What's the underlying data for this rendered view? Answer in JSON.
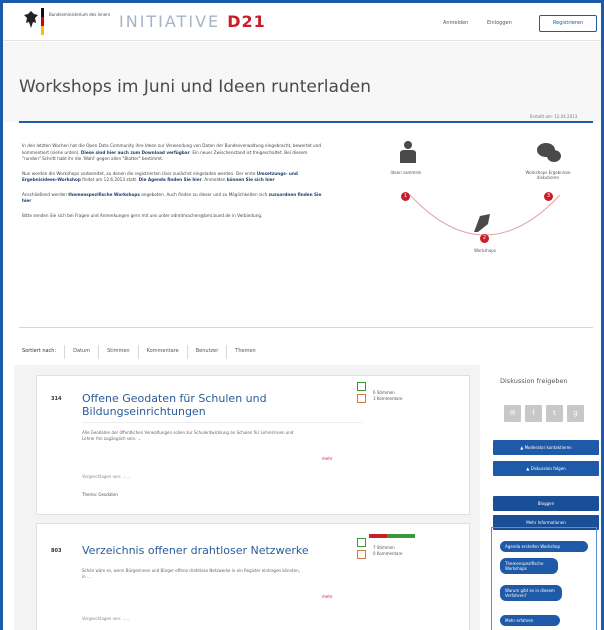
{
  "header": {
    "ministry": "Bundesministerium des Innern",
    "brand_prefix": "INITIATIVE",
    "brand_suffix": "D21",
    "brand_sub": "",
    "nav": [
      "Anmelden",
      "Einloggen"
    ],
    "register": "Registrieren"
  },
  "page": {
    "title": "Workshops im Juni und Ideen runterladen",
    "created": "Erstellt am: 12.04.2013"
  },
  "intro": {
    "p1a": "In den letzten Wochen hat die Open Data Community ihre Ideen zur Verwendung von Daten der Bundesverwaltung eingebracht, bewertet und kommentiert (siehe unten). ",
    "p1b": "Diese sind hier auch zum Download verfügbar",
    "p1c": ". Ein neuer Zwischenstand ist freigeschaltet. Bei diesem \"runden\" Schritt habt ihr die 'Wahl' gegen allen \"Blatter\" bestimmt.",
    "p2a": "Nun werden die Workshops vorbereitet, zu denen die registrierten User zunächst eingeladen werden. Der erste ",
    "p2b": "Umsetzungs- und Ergebnisideen-Workshop",
    "p2c": " findet am 12.6.2013 statt. ",
    "p2d": "Die Agenda finden Sie hier",
    "p2e": ". Anmelden ",
    "p2f": "können Sie sich hier",
    "p3a": "Anschließend werden ",
    "p3b": "themenspezifische Workshops",
    "p3c": " angeboten. Auch finden zu dieser und zu Möglichkeiten sich ",
    "p3d": "zuzuordnen finden Sie hier",
    "p4": "Bitte senden Sie sich bei Fragen und Anmerkungen gern mit uns unter odmitmachen@bmi.bund.de in Verbindung."
  },
  "diagram": {
    "step1": "Ideen sammeln",
    "step2": "Workshops",
    "step3": "Workshops Ergebnisse diskutieren",
    "n1": "1",
    "n2": "2",
    "n3": "3"
  },
  "tabs": [
    "Sortiert nach:",
    "Datum",
    "Stimmen",
    "Kommentare",
    "Benutzer",
    "Themen"
  ],
  "cards": [
    {
      "num": "314",
      "title": "Offene Geodaten für Schulen und Bildungseinrichtungen",
      "desc": "Alle Geodaten der öffentlichen Verwaltungen sollen zur Schulentwicklung an Schulen für Lehrerinnen und Lehrer frei zugänglich sein. ...",
      "more": "mehr",
      "author": "Vorgeschlagen von: ......",
      "tag": "Thema: Geodaten",
      "stat1": "6 Stimmen",
      "stat2": "3 Kommentare"
    },
    {
      "num": "803",
      "title": "Verzeichnis offener drahtloser Netzwerke",
      "desc": "Schön wäre es, wenn Bürgerinnen und Bürger offene drahtlose Netzwerke in ein Register eintragen könnten, in ...",
      "more": "mehr",
      "author": "Vorgeschlagen von: ......",
      "stat1": "7 Stimmen",
      "stat2": "0 Kommentare"
    }
  ],
  "sidebar": {
    "title": "Diskussion freigeben",
    "share_icons": [
      "email-icon",
      "facebook-icon",
      "twitter-icon",
      "google-icon"
    ],
    "btn_moderator": "Moderator kontaktieren",
    "btn_discussion": "Diskussion folgen",
    "btn_bloggen": "Bloggen",
    "btn_infos": "Mehr Informationen",
    "bubbles": [
      "Agenda erstellen Workshop",
      "Themenspezifische Workshops",
      "Warum gibt es in diesem Verfahren?",
      "Mehr erfahren"
    ]
  },
  "colors": {
    "accent": "#1e5aa8",
    "brand_red": "#c81e2a"
  }
}
